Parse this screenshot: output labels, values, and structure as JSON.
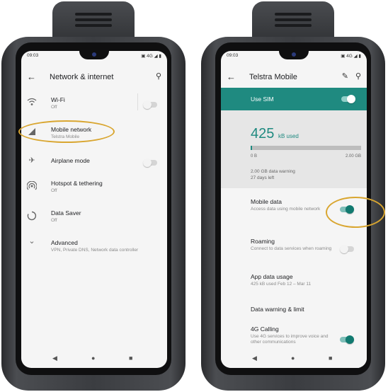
{
  "left_phone": {
    "status": {
      "time": "09:03",
      "icons": "▣ 4G ◢ ▮"
    },
    "appbar": {
      "title": "Network & internet"
    },
    "rows": [
      {
        "title": "Wi-Fi",
        "subtitle": "Off",
        "icon": "wifi-icon",
        "toggle": "off"
      },
      {
        "title": "Mobile network",
        "subtitle": "Telstra Mobile",
        "icon": "cell-signal-icon"
      },
      {
        "title": "Airplane mode",
        "icon": "airplane-icon",
        "toggle": "off"
      },
      {
        "title": "Hotspot & tethering",
        "subtitle": "Off",
        "icon": "hotspot-icon"
      },
      {
        "title": "Data Saver",
        "subtitle": "Off",
        "icon": "data-saver-icon"
      },
      {
        "title": "Advanced",
        "subtitle": "VPN, Private DNS, Network data controller",
        "icon": "chevron-down-icon"
      }
    ]
  },
  "right_phone": {
    "status": {
      "time": "09:03",
      "icons": "▣ 4G ◢ ▮"
    },
    "appbar": {
      "title": "Telstra Mobile"
    },
    "sim": {
      "label": "Use SIM",
      "toggle": "on"
    },
    "usage": {
      "amount": "425",
      "unit": "kB used",
      "min_label": "0 B",
      "max_label": "2.00 GB",
      "warning": "2.00 GB data warning",
      "days_left": "27 days left",
      "fraction_used": 0.0002
    },
    "rows": [
      {
        "title": "Mobile data",
        "subtitle": "Access data using mobile network",
        "toggle": "on"
      },
      {
        "title": "Roaming",
        "subtitle": "Connect to data services when roaming",
        "toggle": "off"
      },
      {
        "title": "App data usage",
        "subtitle": "425 kB used Feb 12 – Mar 11"
      },
      {
        "title": "Data warning & limit"
      },
      {
        "title": "4G Calling",
        "subtitle": "Use 4G services to improve voice and other communications",
        "toggle": "on"
      }
    ]
  },
  "nav": {
    "back": "◀",
    "home": "●",
    "recents": "■"
  },
  "colors": {
    "accent": "#1f8a80",
    "highlight": "#d9a630",
    "frame": "#3b3d41"
  }
}
